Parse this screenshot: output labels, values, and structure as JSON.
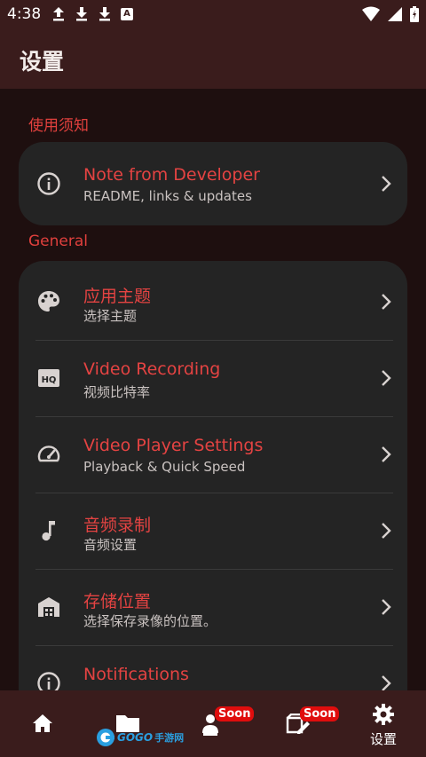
{
  "status_bar": {
    "time": "4:38",
    "a_badge": "A"
  },
  "app_bar": {
    "title": "设置"
  },
  "sections": {
    "notice_label": "使用须知",
    "general_label": "General"
  },
  "notice_card": {
    "items": [
      {
        "title": "Note from Developer",
        "subtitle": "README, links & updates",
        "icon": "info-icon"
      }
    ]
  },
  "general_card": {
    "items": [
      {
        "title": "应用主题",
        "subtitle": "选择主题",
        "icon": "palette-icon"
      },
      {
        "title": "Video Recording",
        "subtitle": "视频比特率",
        "icon": "hq-icon"
      },
      {
        "title": "Video Player Settings",
        "subtitle": "Playback & Quick Speed",
        "icon": "speedometer-icon"
      },
      {
        "title": "音频录制",
        "subtitle": "音频设置",
        "icon": "music-note-icon"
      },
      {
        "title": "存储位置",
        "subtitle": "选择保存录像的位置。",
        "icon": "storage-icon"
      },
      {
        "title": "Notifications",
        "subtitle": "",
        "icon": "info-icon"
      }
    ]
  },
  "bottom_nav": {
    "items": [
      {
        "name": "home",
        "label": "",
        "icon": "home-icon"
      },
      {
        "name": "folder",
        "label": "",
        "icon": "folder-icon"
      },
      {
        "name": "recorder",
        "label": "",
        "icon": "person-recording-icon",
        "badge": "Soon"
      },
      {
        "name": "editor",
        "label": "",
        "icon": "clapper-edit-icon",
        "badge": "Soon"
      },
      {
        "name": "settings",
        "label": "设置",
        "icon": "gear-icon"
      }
    ]
  },
  "watermark": {
    "text": "GOGO",
    "text2": "手游网"
  },
  "colors": {
    "accent": "#e44342",
    "background": "#1e0f0f",
    "bar": "#3a1c1c",
    "card": "#242424",
    "badge": "#e00d0d"
  }
}
